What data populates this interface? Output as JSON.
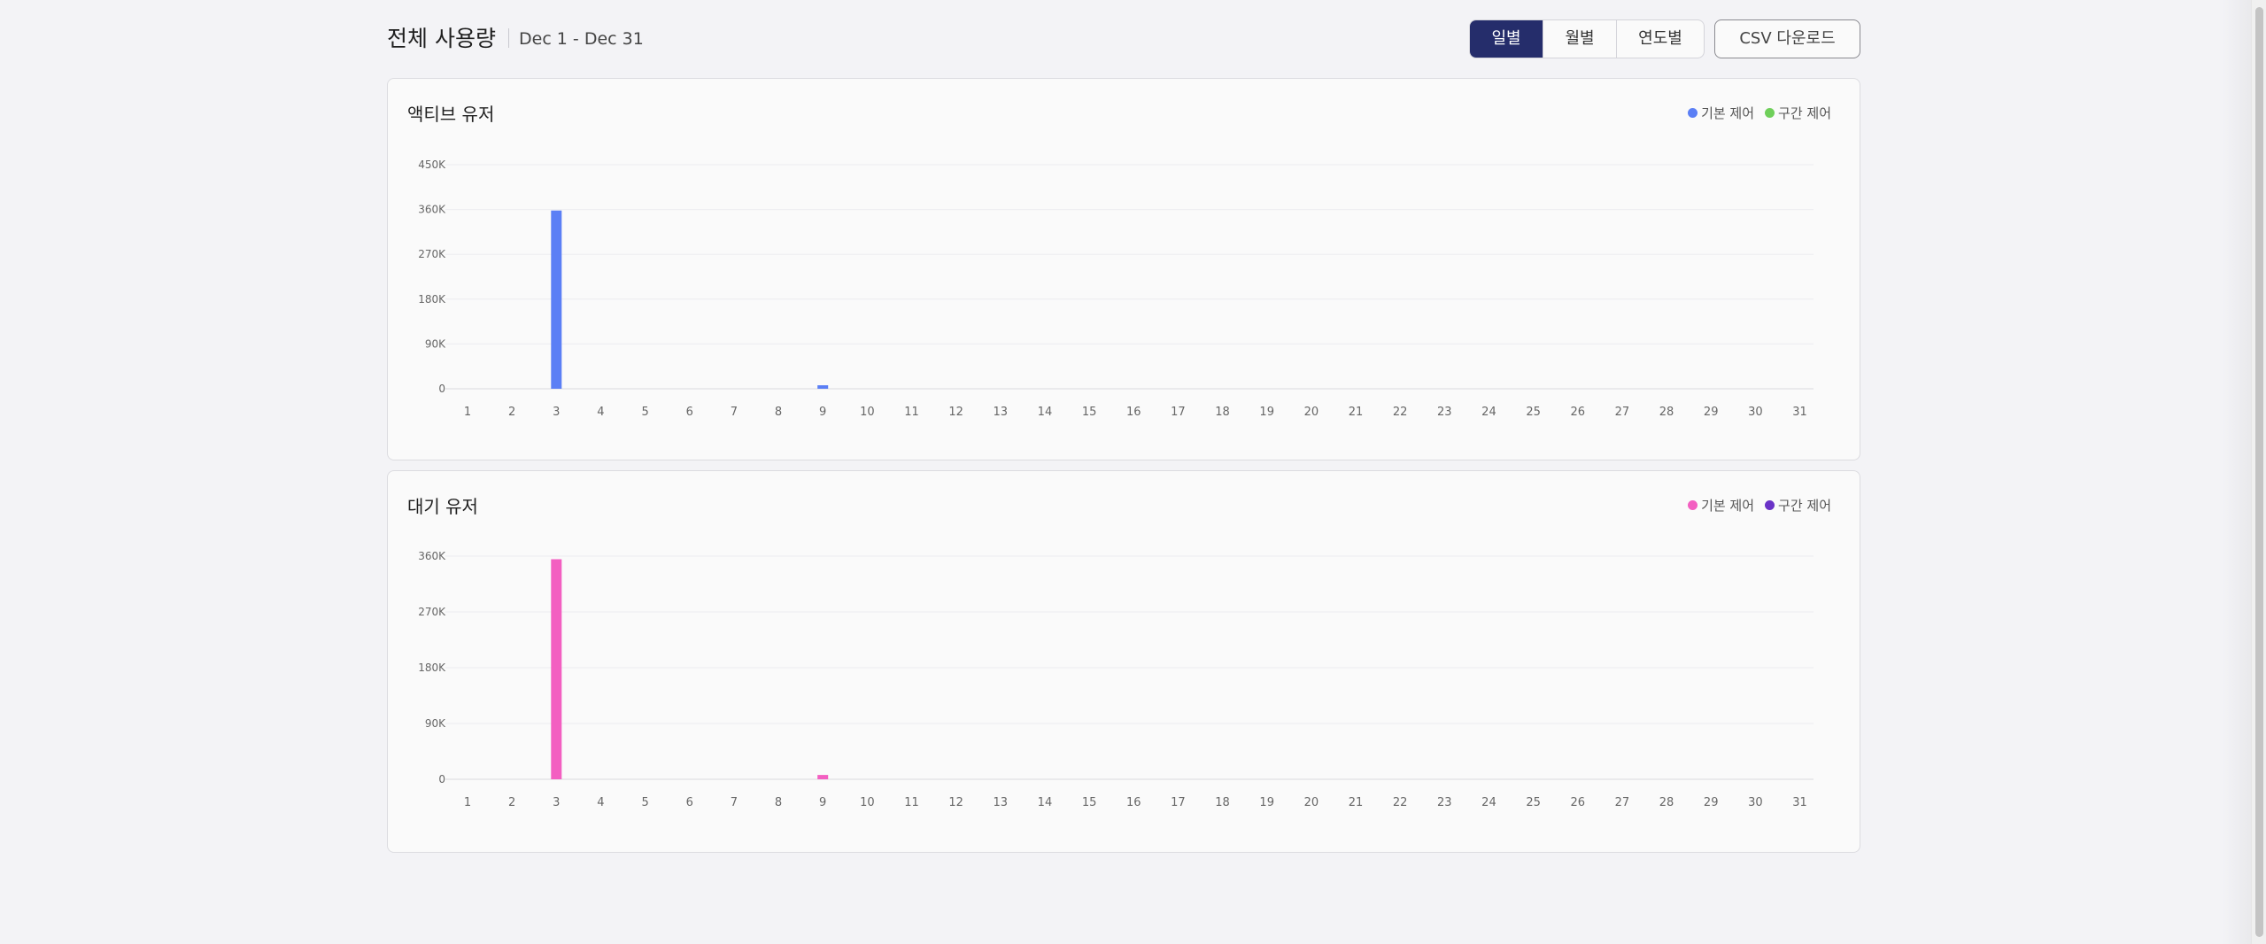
{
  "header": {
    "title": "전체 사용량",
    "date_range": "Dec 1 - Dec 31"
  },
  "period_toggle": {
    "options": [
      "일별",
      "월별",
      "연도별"
    ],
    "selected": "일별"
  },
  "csv_button": {
    "label": "CSV 다운로드"
  },
  "colors": {
    "active_primary": "#5b7ff5",
    "active_secondary": "#6fcf5a",
    "standby_primary": "#f35fc1",
    "standby_secondary": "#6a33c7",
    "toggle_active": "#252d6b"
  },
  "charts": {
    "active": {
      "title": "액티브 유저",
      "legend": [
        {
          "label": "기본 제어",
          "color": "#5b7ff5"
        },
        {
          "label": "구간 제어",
          "color": "#6fcf5a"
        }
      ]
    },
    "standby": {
      "title": "대기 유저",
      "legend": [
        {
          "label": "기본 제어",
          "color": "#f35fc1"
        },
        {
          "label": "구간 제어",
          "color": "#6a33c7"
        }
      ]
    }
  },
  "chart_data": [
    {
      "type": "bar",
      "title": "액티브 유저",
      "categories": [
        "1",
        "2",
        "3",
        "4",
        "5",
        "6",
        "7",
        "8",
        "9",
        "10",
        "11",
        "12",
        "13",
        "14",
        "15",
        "16",
        "17",
        "18",
        "19",
        "20",
        "21",
        "22",
        "23",
        "24",
        "25",
        "26",
        "27",
        "28",
        "29",
        "30",
        "31"
      ],
      "series": [
        {
          "name": "기본 제어",
          "color": "#5b7ff5",
          "values": [
            0,
            0,
            358000,
            0,
            0,
            0,
            0,
            0,
            7000,
            0,
            0,
            0,
            0,
            0,
            0,
            0,
            0,
            0,
            0,
            0,
            0,
            0,
            0,
            0,
            0,
            0,
            0,
            0,
            0,
            0,
            0
          ]
        },
        {
          "name": "구간 제어",
          "color": "#6fcf5a",
          "values": [
            0,
            0,
            0,
            0,
            0,
            0,
            0,
            0,
            0,
            0,
            0,
            0,
            0,
            0,
            0,
            0,
            0,
            0,
            0,
            0,
            0,
            0,
            0,
            0,
            0,
            0,
            0,
            0,
            0,
            0,
            0
          ]
        }
      ],
      "yticks": [
        "0",
        "90K",
        "180K",
        "270K",
        "360K",
        "450K"
      ],
      "ylim": [
        0,
        450000
      ],
      "grid": true,
      "legend_position": "top-right"
    },
    {
      "type": "bar",
      "title": "대기 유저",
      "categories": [
        "1",
        "2",
        "3",
        "4",
        "5",
        "6",
        "7",
        "8",
        "9",
        "10",
        "11",
        "12",
        "13",
        "14",
        "15",
        "16",
        "17",
        "18",
        "19",
        "20",
        "21",
        "22",
        "23",
        "24",
        "25",
        "26",
        "27",
        "28",
        "29",
        "30",
        "31"
      ],
      "series": [
        {
          "name": "기본 제어",
          "color": "#f35fc1",
          "values": [
            0,
            0,
            355000,
            0,
            0,
            0,
            0,
            0,
            7000,
            0,
            0,
            0,
            0,
            0,
            0,
            0,
            0,
            0,
            0,
            0,
            0,
            0,
            0,
            0,
            0,
            0,
            0,
            0,
            0,
            0,
            0
          ]
        },
        {
          "name": "구간 제어",
          "color": "#6a33c7",
          "values": [
            0,
            0,
            0,
            0,
            0,
            0,
            0,
            0,
            0,
            0,
            0,
            0,
            0,
            0,
            0,
            0,
            0,
            0,
            0,
            0,
            0,
            0,
            0,
            0,
            0,
            0,
            0,
            0,
            0,
            0,
            0
          ]
        }
      ],
      "yticks": [
        "0",
        "90K",
        "180K",
        "270K",
        "360K"
      ],
      "ylim": [
        0,
        360000
      ],
      "grid": true,
      "legend_position": "top-right"
    }
  ]
}
